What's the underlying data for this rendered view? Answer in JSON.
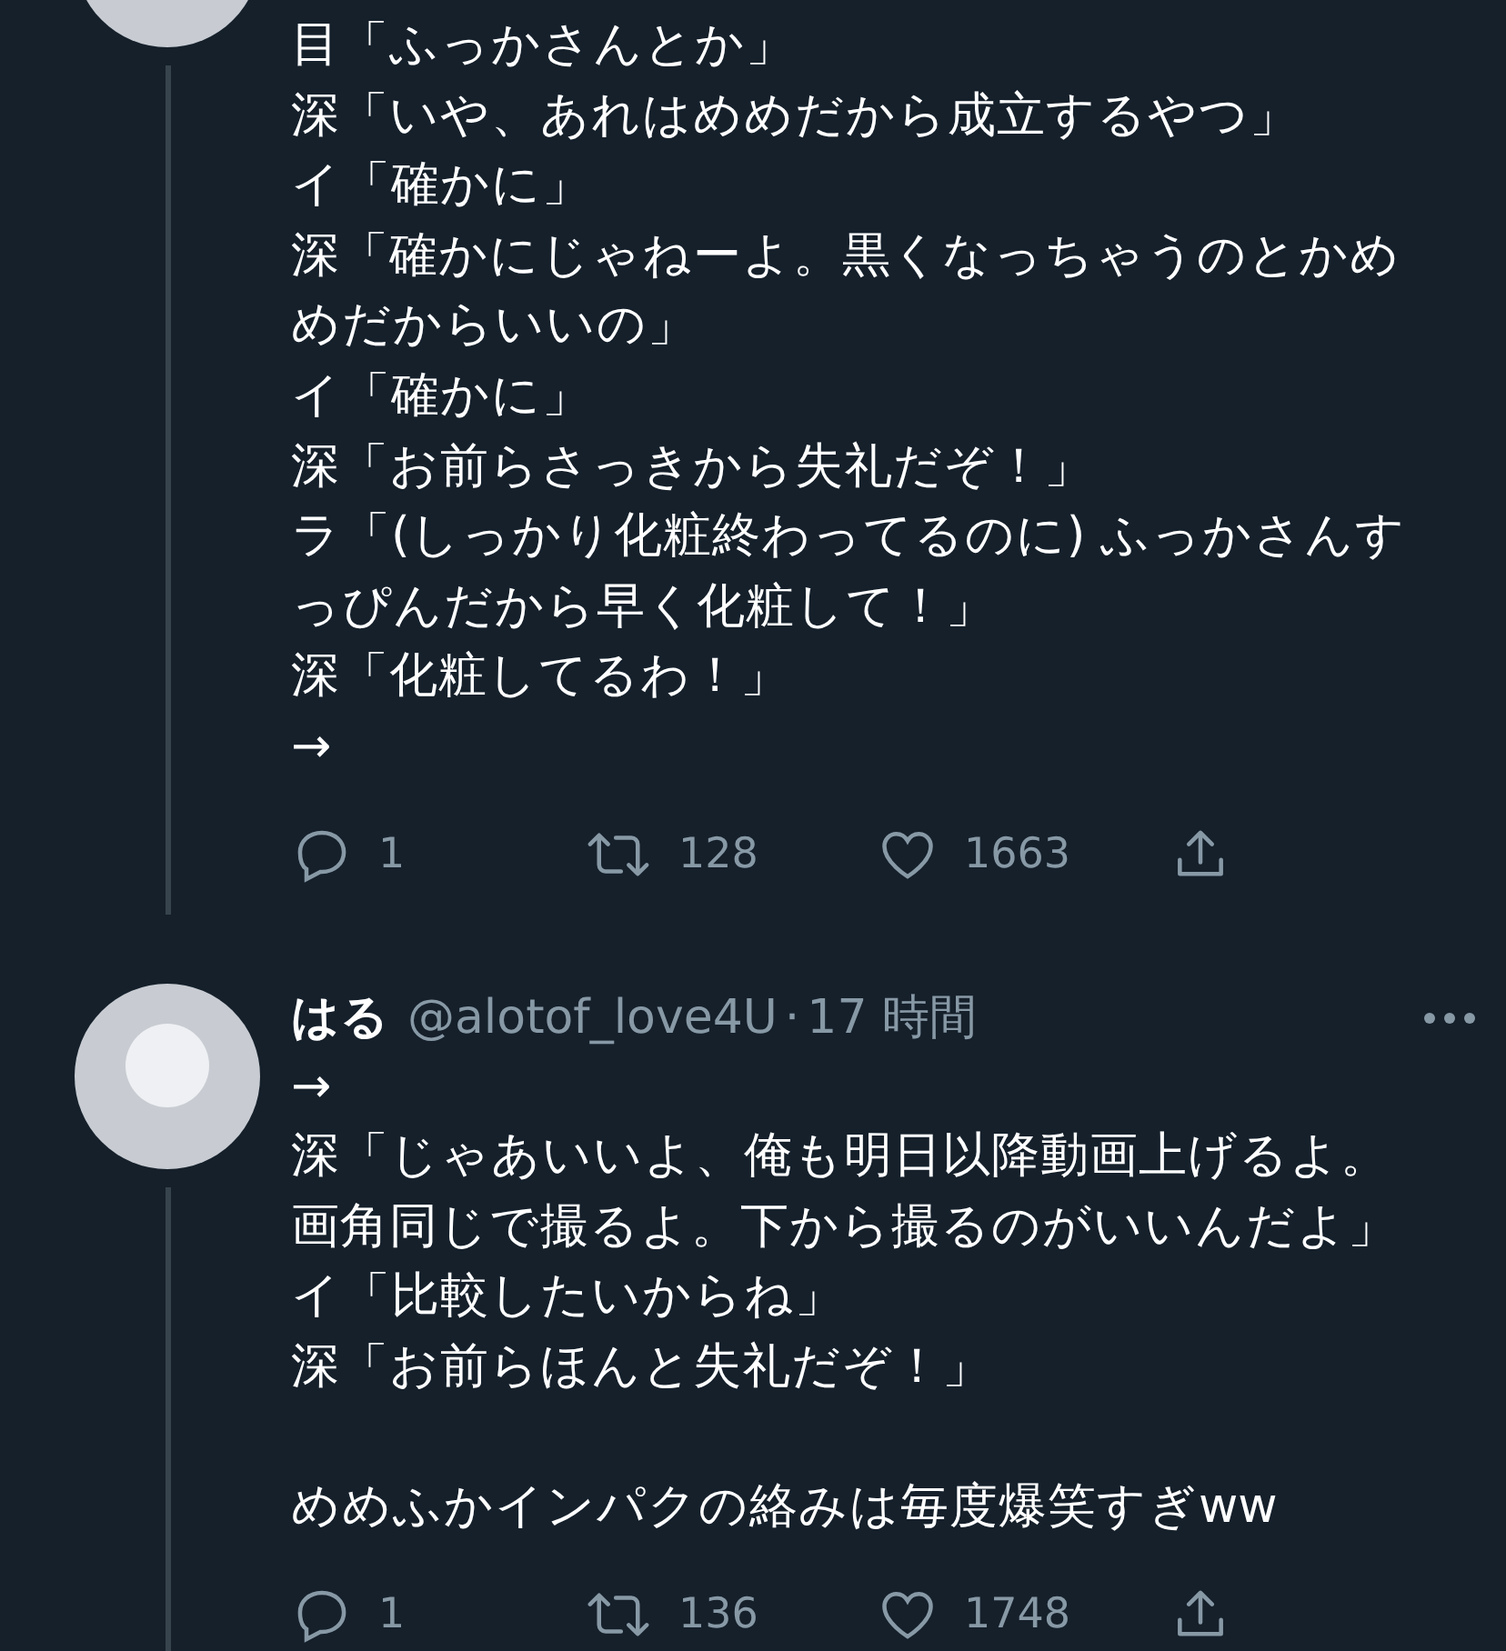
{
  "tweets": [
    {
      "paragraphs": [
        [
          "目「ふっかさんとか」",
          "深「いや、あれはめめだから成立するやつ」",
          "イ「確かに」",
          "深「確かにじゃねーよ。黒くなっちゃうのとかめ",
          "めだからいいの」",
          "イ「確かに」",
          "深「お前らさっきから失礼だぞ！」",
          "ラ「(しっかり化粧終わってるのに) ふっかさんす",
          "っぴんだから早く化粧して！」",
          "深「化粧してるわ！」",
          "→"
        ]
      ],
      "actions": [
        {
          "kind": "reply",
          "count": "1"
        },
        {
          "kind": "retweet",
          "count": "128"
        },
        {
          "kind": "like",
          "count": "1663"
        },
        {
          "kind": "share"
        }
      ]
    },
    {
      "name": "はる",
      "handle": "@alotof_love4U",
      "separator": "·",
      "time": "17 時間",
      "paragraphs": [
        [
          "→",
          "深「じゃあいいよ、俺も明日以降動画上げるよ。",
          "画角同じで撮るよ。下から撮るのがいいんだよ」",
          "イ「比較したいからね」",
          "深「お前らほんと失礼だぞ！」"
        ],
        [
          "めめふかインパクの絡みは毎度爆笑すぎww"
        ]
      ],
      "actions": [
        {
          "kind": "reply",
          "count": "1"
        },
        {
          "kind": "retweet",
          "count": "136"
        },
        {
          "kind": "like",
          "count": "1748"
        },
        {
          "kind": "share"
        }
      ]
    }
  ]
}
